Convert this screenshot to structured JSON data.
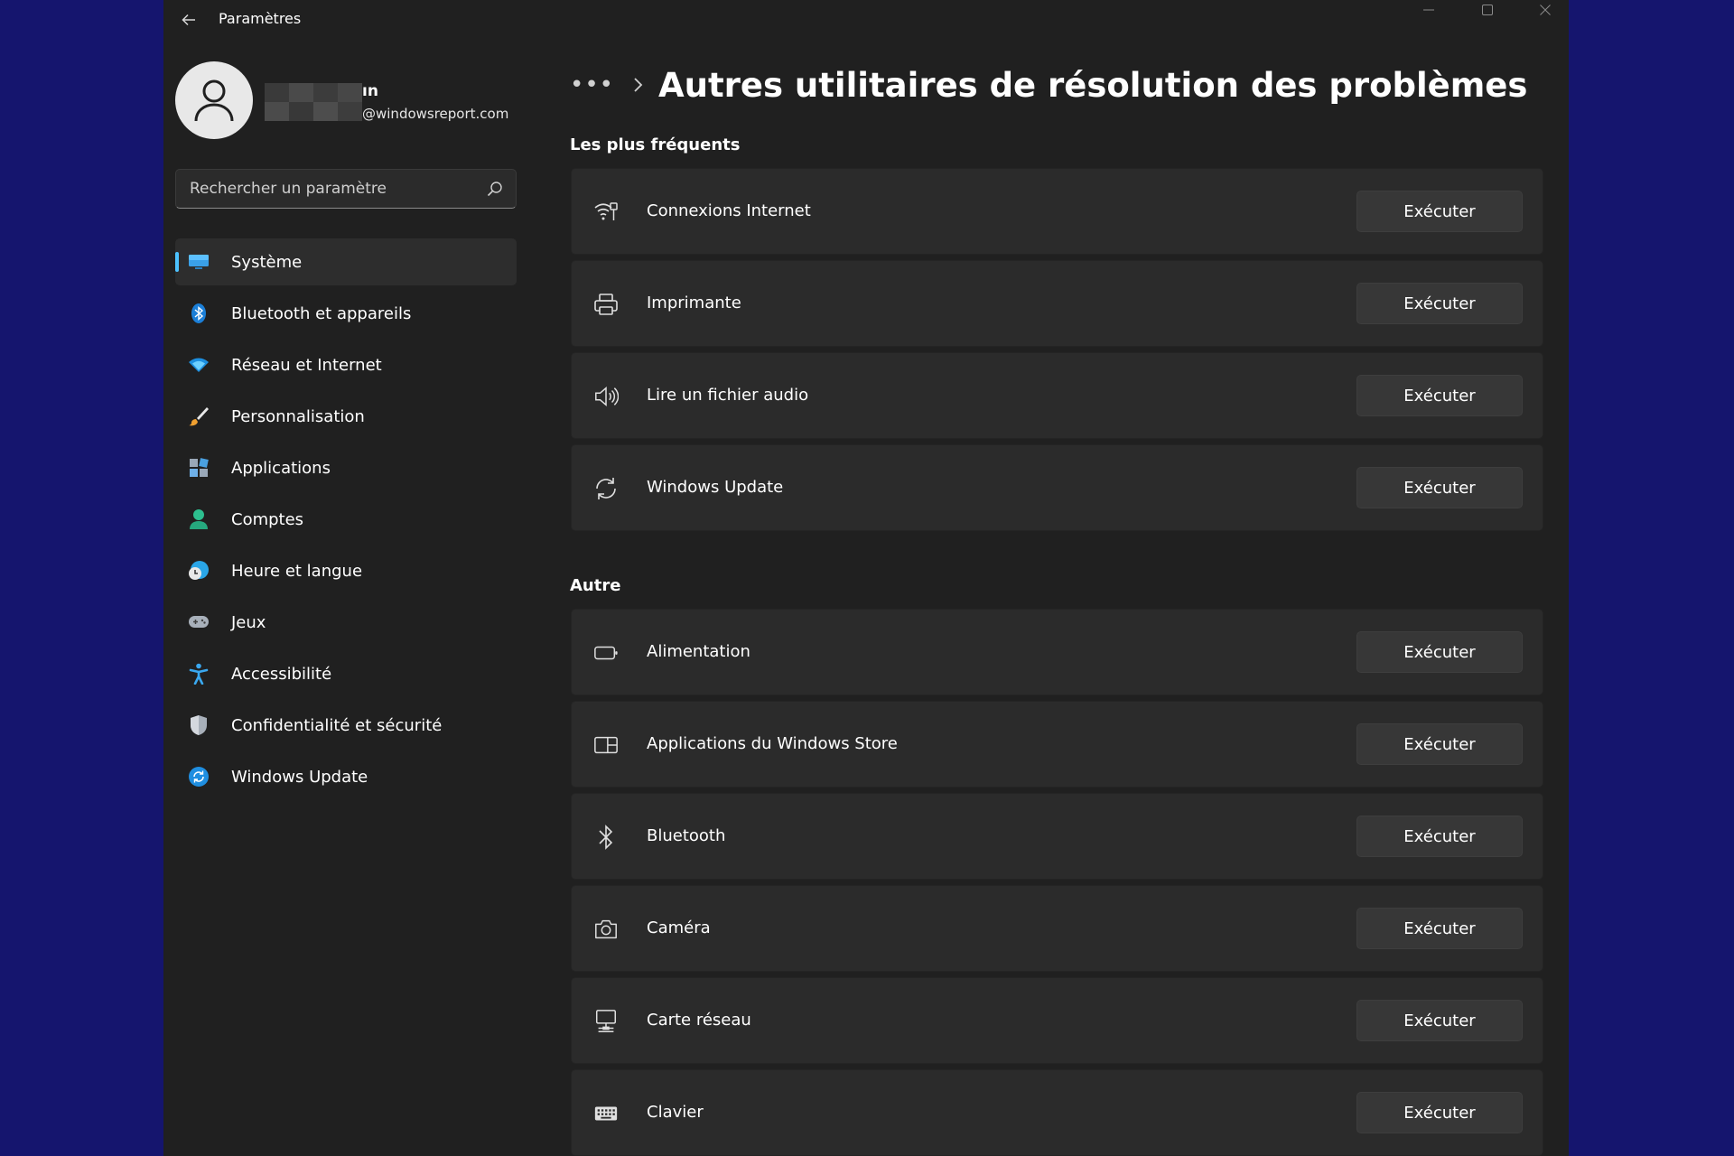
{
  "window": {
    "title": "Paramètres",
    "back_icon": "back-arrow-icon",
    "controls": [
      "minimize-icon",
      "maximize-icon",
      "close-icon"
    ]
  },
  "profile": {
    "name_suffix": "ın",
    "email": "@windowsreport.com",
    "avatar_icon": "user-icon"
  },
  "search": {
    "placeholder": "Rechercher un paramètre",
    "icon": "search-icon"
  },
  "nav": {
    "items": [
      {
        "label": "Système",
        "icon": "monitor-icon",
        "active": true
      },
      {
        "label": "Bluetooth et appareils",
        "icon": "bluetooth-icon"
      },
      {
        "label": "Réseau et Internet",
        "icon": "wifi-icon"
      },
      {
        "label": "Personnalisation",
        "icon": "brush-icon"
      },
      {
        "label": "Applications",
        "icon": "apps-icon"
      },
      {
        "label": "Comptes",
        "icon": "account-icon"
      },
      {
        "label": "Heure et langue",
        "icon": "globe-clock-icon"
      },
      {
        "label": "Jeux",
        "icon": "gamepad-icon"
      },
      {
        "label": "Accessibilité",
        "icon": "accessibility-icon"
      },
      {
        "label": "Confidentialité et sécurité",
        "icon": "shield-icon"
      },
      {
        "label": "Windows Update",
        "icon": "update-icon"
      }
    ]
  },
  "main": {
    "breadcrumb_more": "•••",
    "title": "Autres utilitaires de résolution des problèmes",
    "sections": [
      {
        "title": "Les plus fréquents",
        "items": [
          {
            "label": "Connexions Internet",
            "icon": "wifi-ethernet-icon",
            "button": "Exécuter"
          },
          {
            "label": "Imprimante",
            "icon": "printer-icon",
            "button": "Exécuter"
          },
          {
            "label": "Lire un fichier audio",
            "icon": "speaker-icon",
            "button": "Exécuter"
          },
          {
            "label": "Windows Update",
            "icon": "refresh-icon",
            "button": "Exécuter"
          }
        ]
      },
      {
        "title": "Autre",
        "items": [
          {
            "label": "Alimentation",
            "icon": "battery-icon",
            "button": "Exécuter"
          },
          {
            "label": "Applications du Windows Store",
            "icon": "store-icon",
            "button": "Exécuter"
          },
          {
            "label": "Bluetooth",
            "icon": "bluetooth-icon",
            "button": "Exécuter"
          },
          {
            "label": "Caméra",
            "icon": "camera-icon",
            "button": "Exécuter"
          },
          {
            "label": "Carte réseau",
            "icon": "network-adapter-icon",
            "button": "Exécuter"
          },
          {
            "label": "Clavier",
            "icon": "keyboard-icon",
            "button": "Exécuter"
          }
        ]
      }
    ]
  },
  "colors": {
    "desktop": "#15156e",
    "window": "#202020",
    "card": "#2b2b2b",
    "button": "#373737",
    "accent": "#4cc2ff"
  }
}
